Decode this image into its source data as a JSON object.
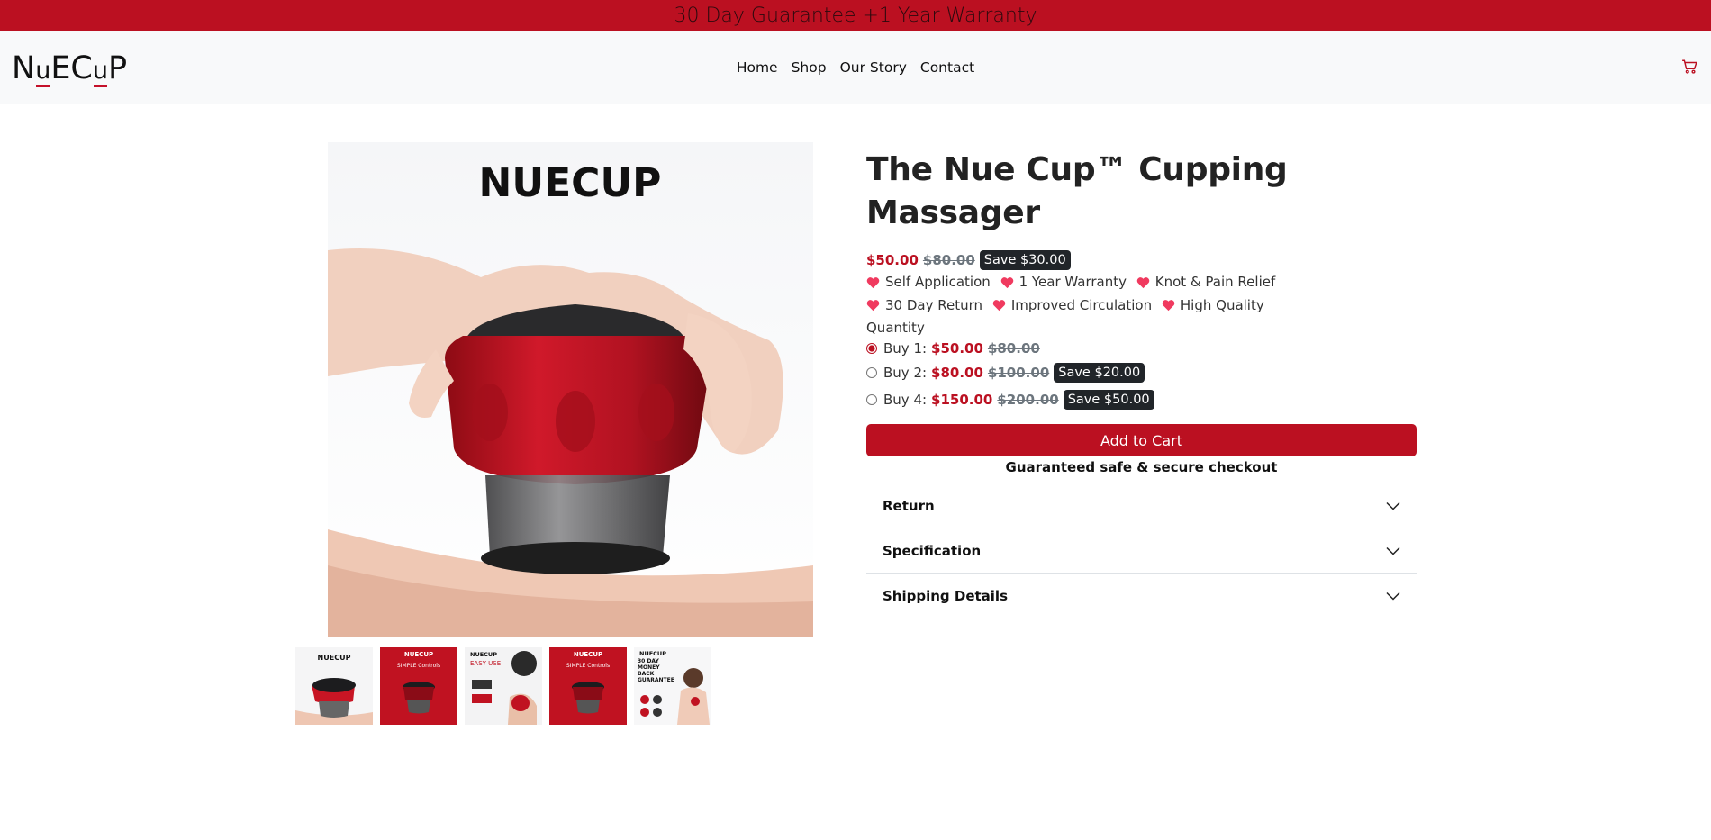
{
  "announcement": "30 Day Guarantee +1 Year Warranty",
  "brand": {
    "logo_parts": [
      "N",
      "u",
      "EC",
      "u",
      "P"
    ],
    "accent": "#c4112a"
  },
  "nav": {
    "items": [
      "Home",
      "Shop",
      "Our Story",
      "Contact"
    ],
    "cart_icon": "cart-icon"
  },
  "gallery": {
    "main_logo_text": "NUECUP",
    "thumbnails": [
      {
        "label": "NUECUP"
      },
      {
        "label": "NUECUP",
        "caption": "SIMPLE Controls"
      },
      {
        "label": "NUECUP",
        "caption": "EASY USE"
      },
      {
        "label": "NUECUP",
        "caption": "SIMPLE Controls"
      },
      {
        "label": "NUECUP",
        "caption": "30 DAY MONEY BACK GUARANTEE"
      }
    ]
  },
  "product": {
    "title": "The Nue Cup™ Cupping Massager",
    "price": "$50.00",
    "compare_price": "$80.00",
    "save_badge": "Save $30.00",
    "features_row1": [
      "Self Application",
      "1 Year Warranty",
      "Knot & Pain Relief"
    ],
    "features_row2": [
      "30 Day Return",
      "Improved Circulation",
      "High Quality"
    ],
    "quantity_label": "Quantity",
    "options": [
      {
        "label": "Buy 1:",
        "price": "$50.00",
        "compare": "$80.00",
        "badge": ""
      },
      {
        "label": "Buy 2:",
        "price": "$80.00",
        "compare": "$100.00",
        "badge": "Save $20.00"
      },
      {
        "label": "Buy 4:",
        "price": "$150.00",
        "compare": "$200.00",
        "badge": "Save $50.00"
      }
    ],
    "selected_option": 0,
    "add_to_cart": "Add to Cart",
    "secure_text": "Guaranteed safe & secure checkout",
    "accordion": [
      "Return",
      "Specification",
      "Shipping Details"
    ]
  },
  "colors": {
    "primary": "#bb1021",
    "dark_badge": "#212529",
    "navbar_bg": "#f8f9fa"
  }
}
